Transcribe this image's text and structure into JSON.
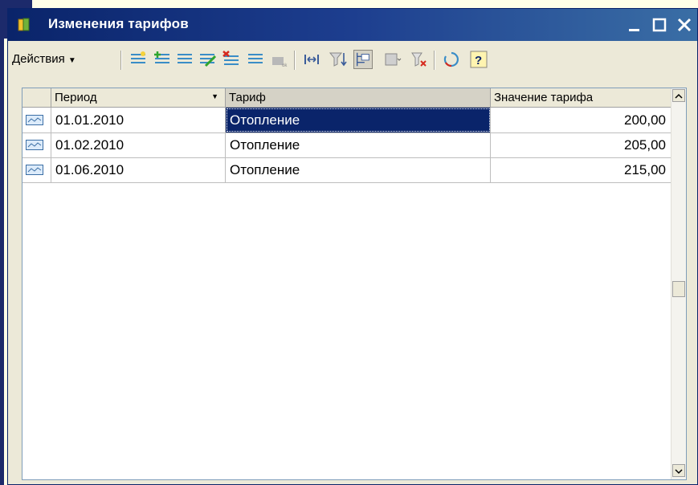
{
  "window": {
    "title": "Изменения тарифов",
    "icon": "book-icon"
  },
  "toolbar": {
    "actions_label": "Действия",
    "icons": [
      "add-row-icon",
      "add-copy-icon",
      "edit-row-icon",
      "delete-row-icon",
      "post-icon",
      "select-columns-icon",
      "sort-icon",
      "tree-view-icon",
      "filter-icon",
      "clear-filter-icon",
      "refresh-icon",
      "help-icon"
    ]
  },
  "table": {
    "columns": [
      "Период",
      "Тариф",
      "Значение тарифа"
    ],
    "rows": [
      {
        "period": "01.01.2010",
        "tariff": "Отопление",
        "value": "200,00"
      },
      {
        "period": "01.02.2010",
        "tariff": "Отопление",
        "value": "205,00"
      },
      {
        "period": "01.06.2010",
        "tariff": "Отопление",
        "value": "215,00"
      }
    ]
  },
  "colors": {
    "title_bar": "#0A246A",
    "selection": "#0A246A",
    "window_bg": "#ECE9D8",
    "desktop": "#FFFFE8"
  }
}
